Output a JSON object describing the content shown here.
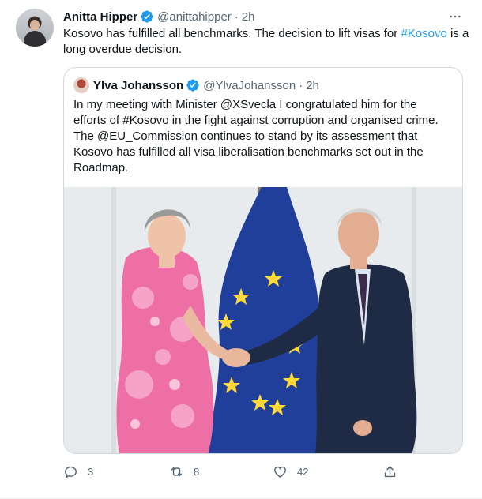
{
  "tweet": {
    "author_name": "Anitta Hipper",
    "author_handle": "@anittahipper",
    "separator": "·",
    "time": "2h",
    "text_plain": "Kosovo has fulfilled all benchmarks. The decision to lift visas for ",
    "hashtag": "#Kosovo",
    "text_after": " is a long overdue decision."
  },
  "quote": {
    "author_name": "Ylva Johansson",
    "author_handle": "@YlvaJohansson",
    "separator": "·",
    "time": "2h",
    "text": "In my meeting with Minister @XSvecla I congratulated him for the efforts of #Kosovo in the fight against corruption and organised crime. The @EU_Commission continues to stand by its assessment that Kosovo has fulfilled all visa liberalisation benchmarks set out in the Roadmap."
  },
  "actions": {
    "reply_count": "3",
    "retweet_count": "8",
    "like_count": "42"
  },
  "icons": {
    "verified": "verified-badge-icon",
    "more": "more-icon",
    "reply": "reply-icon",
    "retweet": "retweet-icon",
    "like": "like-icon",
    "share": "share-icon"
  },
  "colors": {
    "accent": "#1d9bf0",
    "secondary_text": "#536471",
    "primary_text": "#0f1419",
    "border": "#cfd9de"
  }
}
